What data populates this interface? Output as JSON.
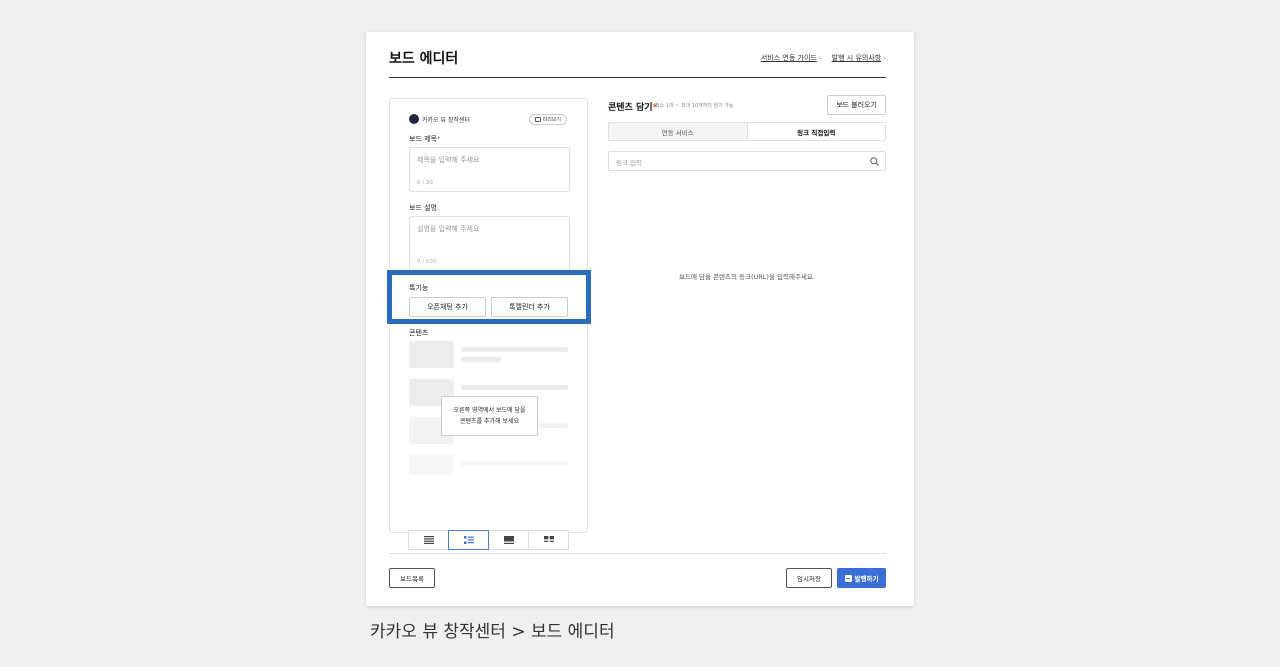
{
  "header": {
    "title": "보드 에디터",
    "links": [
      "서비스 연동 가이드",
      "발행 시 유의사항"
    ]
  },
  "editor": {
    "brand": "카카오 뷰 창작센터",
    "preview_label": "미리보기",
    "board_title_label": "보드 제목",
    "board_title_placeholder": "제목을 입력해 주세요",
    "board_title_count": "0 / 30",
    "board_desc_label": "보드 설명",
    "board_desc_placeholder": "설명을 입력해 주세요",
    "board_desc_count": "0 / 100",
    "tok_label": "톡기능",
    "tok_buttons": [
      "오픈채팅 추가",
      "톡캘린더 추가"
    ],
    "contents_label": "콘텐츠",
    "tooltip_line1": "오른쪽 영역에서 보드에 담을",
    "tooltip_line2": "콘텐츠를 추가해 보세요",
    "layout_icons": [
      "list-lines-icon",
      "list-bullet-icon",
      "card-icon",
      "grid-icon"
    ],
    "layout_selected": 1
  },
  "content_panel": {
    "title": "콘텐츠 담기",
    "hint": "최소 1개 ~ 최대 10개까지 담기 가능",
    "load_button": "보드 불러오기",
    "tabs": [
      "연동 서비스",
      "링크 직접입력"
    ],
    "active_tab": 1,
    "link_placeholder": "링크 입력",
    "empty_message": "보드에 담을 콘텐츠의 링크(URL)을 입력해주세요."
  },
  "footer": {
    "list_button": "보드목록",
    "temp_save_button": "임시저장",
    "publish_button": "발행하기"
  },
  "colors": {
    "highlight": "#2a6ebb",
    "primary": "#3c6fd6",
    "required": "#e74c3c"
  },
  "caption": "카카오 뷰 창작센터 > 보드 에디터"
}
